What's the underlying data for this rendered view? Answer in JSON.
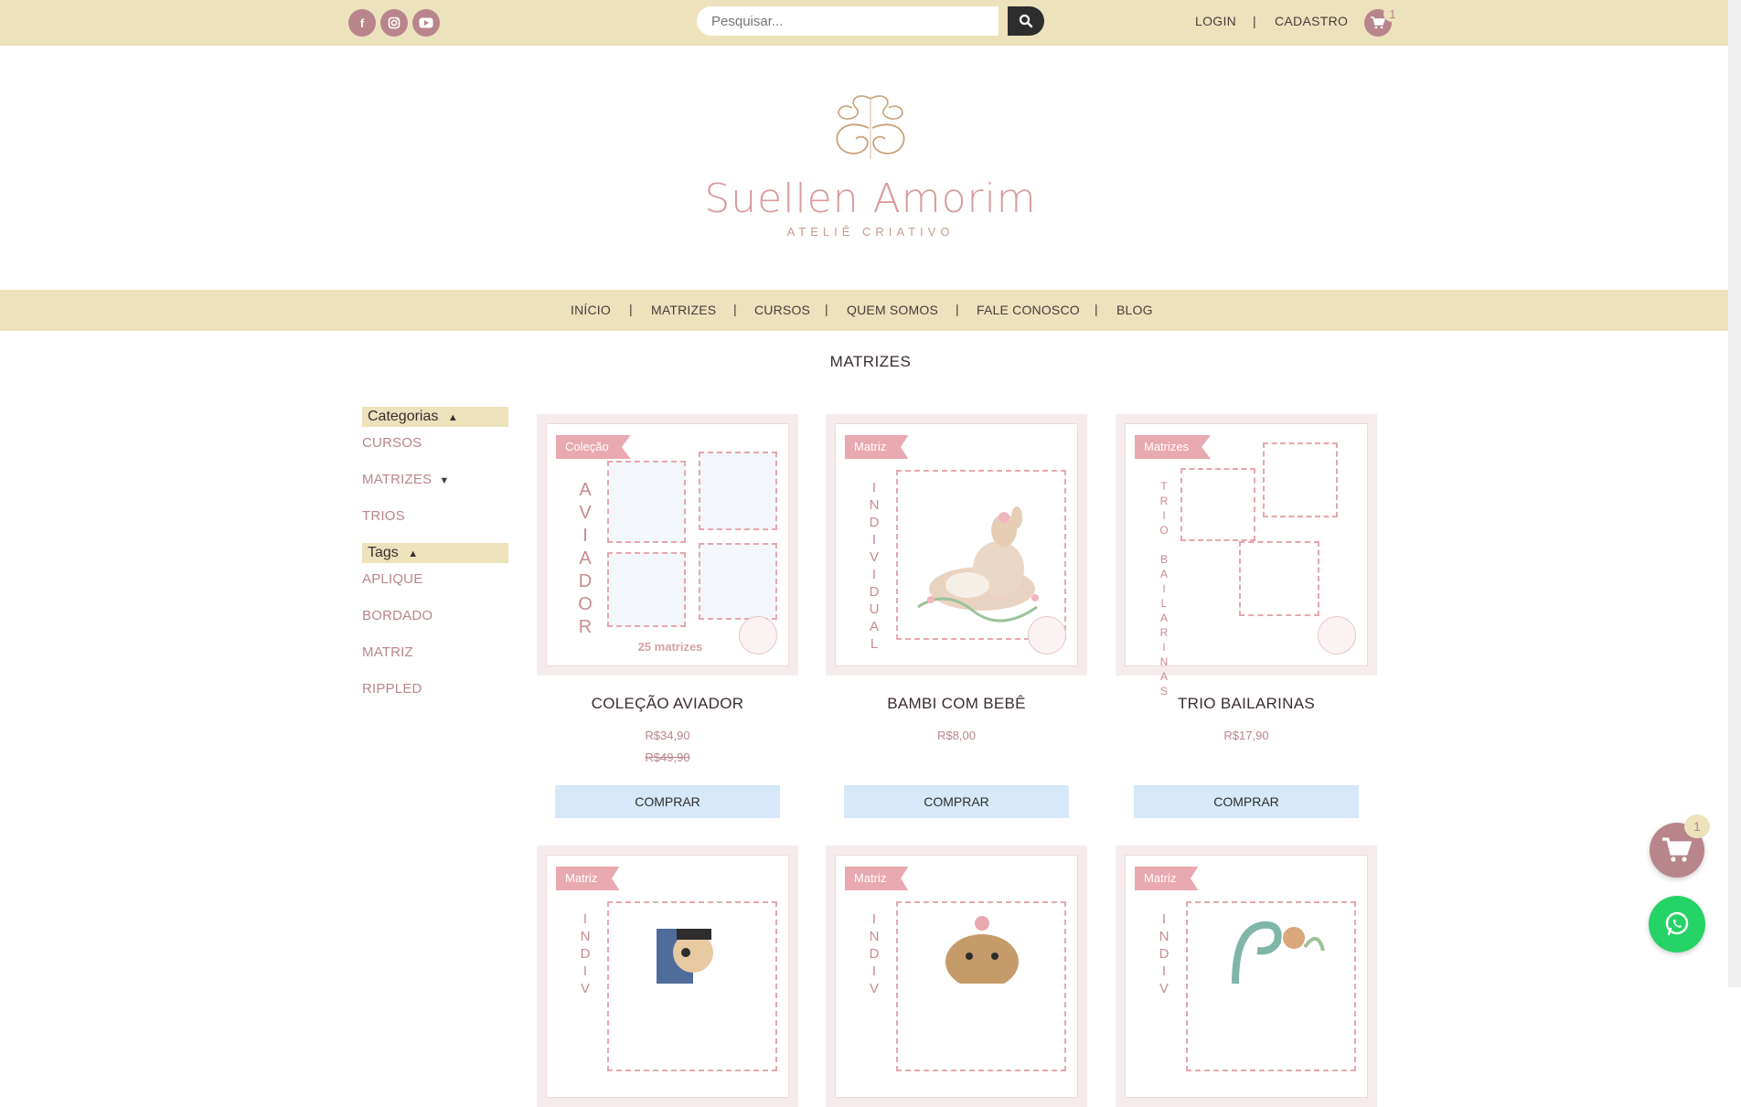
{
  "header": {
    "social": [
      "facebook-icon",
      "instagram-icon",
      "youtube-icon"
    ],
    "search_placeholder": "Pesquisar...",
    "login": "LOGIN",
    "separator": "|",
    "register": "CADASTRO",
    "cart_count": "1"
  },
  "logo": {
    "name": "Suellen Amorim",
    "tagline": "ATELIÊ CRIATIVO"
  },
  "nav": [
    "INÍCIO",
    "MATRIZES",
    "CURSOS",
    "QUEM SOMOS",
    "FALE CONOSCO",
    "BLOG"
  ],
  "page_title": "MATRIZES",
  "sidebar": {
    "categories_title": "Categorias",
    "categories": [
      "CURSOS",
      "MATRIZES",
      "TRIOS"
    ],
    "tags_title": "Tags",
    "tags": [
      "APLIQUE",
      "BORDADO",
      "MATRIZ",
      "RIPPLED"
    ]
  },
  "products": [
    {
      "ribbon": "Coleção",
      "vertical": "AVIADOR",
      "footer": "25 matrizes",
      "name": "COLEÇÃO AVIADOR",
      "price": "R$34,90",
      "old_price": "R$49,90",
      "button": "COMPRAR"
    },
    {
      "ribbon": "Matriz",
      "vertical": "INDIVIDUAL",
      "name": "BAMBI COM BEBÊ",
      "price": "R$8,00",
      "button": "COMPRAR"
    },
    {
      "ribbon": "Matrizes",
      "vertical": "TRIO BAILARINAS",
      "name": "TRIO BAILARINAS",
      "price": "R$17,90",
      "button": "COMPRAR"
    },
    {
      "ribbon": "Matriz",
      "vertical": "INDIV"
    },
    {
      "ribbon": "Matriz",
      "vertical": "INDIV"
    },
    {
      "ribbon": "Matriz",
      "vertical": "INDIV"
    }
  ],
  "floating": {
    "cart_count": "1"
  },
  "colors": {
    "accent": "#b9858c",
    "band": "#ece3bd",
    "button": "#d6e8f9",
    "whatsapp": "#25d366"
  }
}
